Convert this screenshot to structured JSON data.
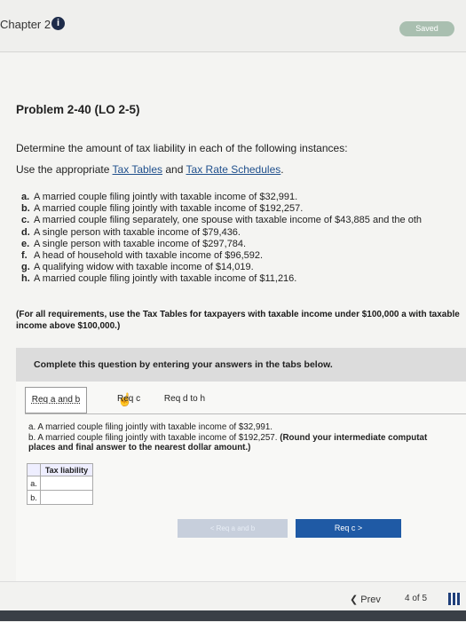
{
  "header": {
    "chapter": "Chapter 2",
    "info_icon": "i",
    "saved_label": "Saved"
  },
  "problem": {
    "title": "Problem 2-40 (LO 2-5)",
    "instruction": "Determine the amount of tax liability in each of the following instances:",
    "use_prefix": "Use the appropriate",
    "link1": "Tax Tables",
    "and_text": "and",
    "link2": "Tax Rate Schedules",
    "period": ".",
    "items": [
      {
        "letter": "a.",
        "text": "A married couple filing jointly with taxable income of $32,991."
      },
      {
        "letter": "b.",
        "text": "A married couple filing jointly with taxable income of $192,257."
      },
      {
        "letter": "c.",
        "text": "A married couple filing separately, one spouse with taxable income of $43,885 and the oth"
      },
      {
        "letter": "d.",
        "text": "A single person with taxable income of $79,436."
      },
      {
        "letter": "e.",
        "text": "A single person with taxable income of $297,784."
      },
      {
        "letter": "f.",
        "text": "A head of household with taxable income of $96,592."
      },
      {
        "letter": "g.",
        "text": "A qualifying widow with taxable income of $14,019."
      },
      {
        "letter": "h.",
        "text": "A married couple filing jointly with taxable income of $11,216."
      }
    ],
    "note": "(For all requirements, use the Tax Tables for taxpayers with taxable income under $100,000 a with taxable income above $100,000.)"
  },
  "panel": {
    "heading": "Complete this question by entering your answers in the tabs below.",
    "tabs": [
      "Req a and b",
      "Req c",
      "Req d to h"
    ],
    "qa": "a. A married couple filing jointly with taxable income of $32,991.",
    "qb": "b. A married couple filing jointly with taxable income of $192,257.",
    "qb_round": "(Round your intermediate computat",
    "qb2": "places and final answer to the nearest dollar amount.)",
    "table_header": "Tax liability",
    "rows": [
      "a.",
      "b."
    ],
    "prev_btn": "<  Req a and b",
    "next_btn": "Req c  >"
  },
  "footer": {
    "prev": "Prev",
    "page": "4 of 5"
  }
}
